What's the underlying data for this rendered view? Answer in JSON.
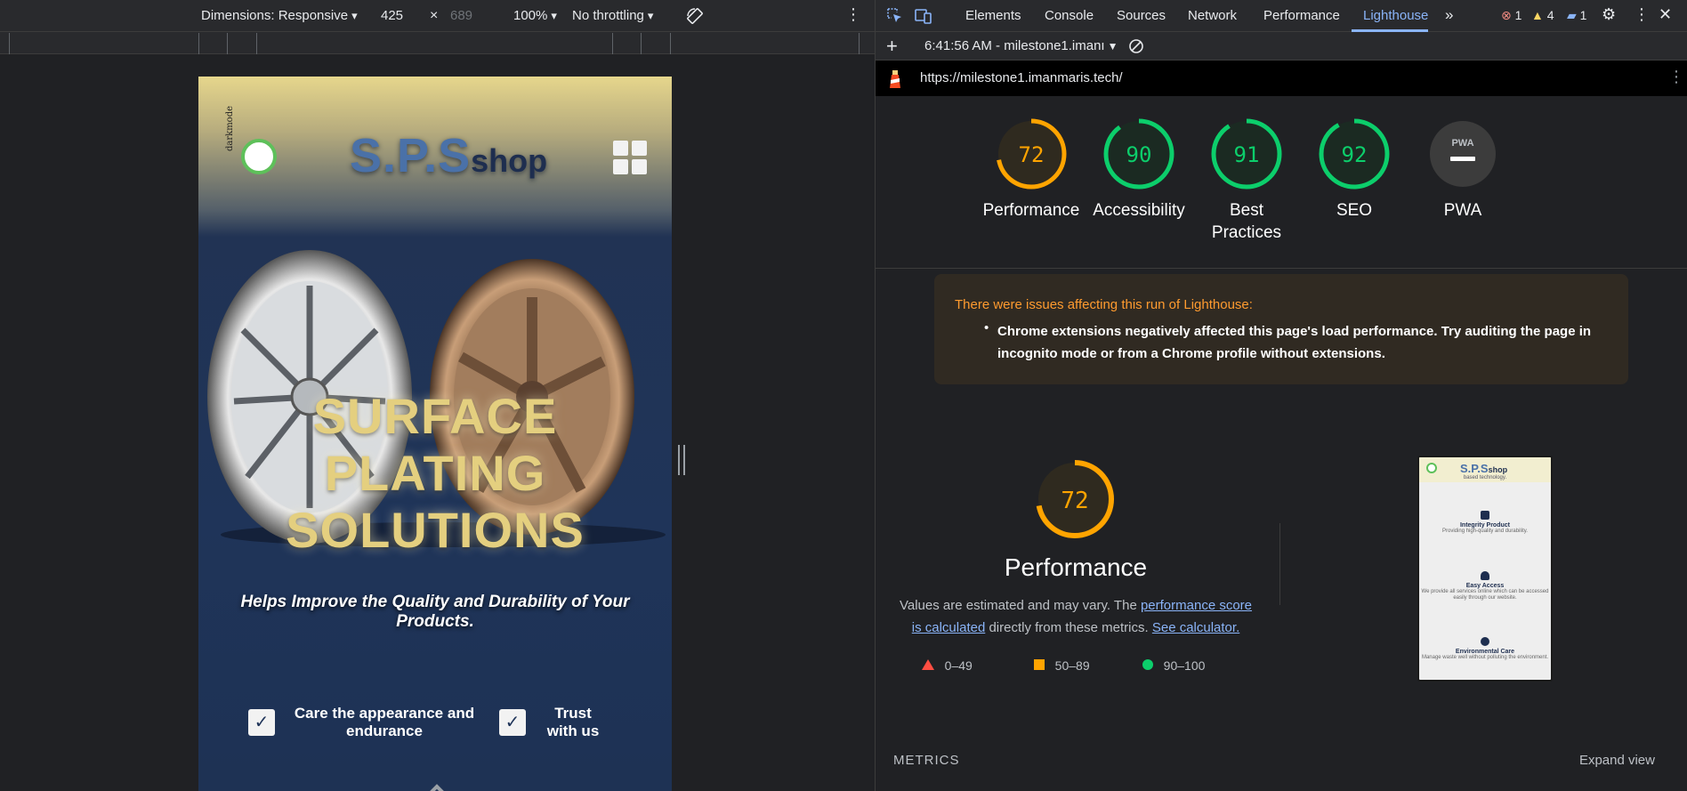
{
  "device_toolbar": {
    "dimensions": "Dimensions: Responsive",
    "width": "425",
    "height": "689",
    "zoom": "100%",
    "throttling": "No throttling"
  },
  "site": {
    "dark_label": "darkmode",
    "logo_big": "S.P.S",
    "logo_small": "shop",
    "hero_title": "SURFACE PLATING SOLUTIONS",
    "hero_subtitle": "Helps Improve the Quality and Durability of Your Products.",
    "features": [
      {
        "label": "Care the appearance and endurance"
      },
      {
        "label": "Trust with us"
      }
    ],
    "check_glyph": "✓"
  },
  "devtools": {
    "tabs": [
      "Elements",
      "Console",
      "Sources",
      "Network",
      "Performance",
      "Lighthouse"
    ],
    "active_tab": "Lighthouse",
    "errors": "1",
    "warnings": "4",
    "messages": "1",
    "report_time": "6:41:56 AM - milestone1.imanı",
    "url": "https://milestone1.imanmaris.tech/"
  },
  "gauges": [
    {
      "label": "Performance",
      "score": 72,
      "color": "#ffa400",
      "bg": "#2f2a1f"
    },
    {
      "label": "Accessibility",
      "score": 90,
      "color": "#0cce6b",
      "bg": "#1b2a22"
    },
    {
      "label": "Best Practices",
      "score": 91,
      "color": "#0cce6b",
      "bg": "#1b2a22"
    },
    {
      "label": "SEO",
      "score": 92,
      "color": "#0cce6b",
      "bg": "#1b2a22"
    },
    {
      "label": "PWA",
      "score": null,
      "color": "#9aa0a6",
      "bg": "#3c3c3c",
      "icon_text": "PWA"
    }
  ],
  "warning": {
    "title": "There were issues affecting this run of Lighthouse:",
    "text": "Chrome extensions negatively affected this page's load performance. Try auditing the page in incognito mode or from a Chrome profile without extensions."
  },
  "performance": {
    "score": "72",
    "title": "Performance",
    "desc_1": "Values are estimated and may vary. The ",
    "link_1": "performance score is calculated",
    "desc_2": " directly from these metrics. ",
    "link_2": "See calculator.",
    "legend": [
      {
        "range": "0–49",
        "shape": "triangle",
        "color": "#ff4e42"
      },
      {
        "range": "50–89",
        "shape": "square",
        "color": "#ffa400"
      },
      {
        "range": "90–100",
        "shape": "circle",
        "color": "#0cce6b"
      }
    ]
  },
  "thumbnail": {
    "logo_big": "S.P.S",
    "logo_small": "shop",
    "tagline": "based technology.",
    "items": [
      {
        "title": "Integrity Product",
        "desc": "Providing high-quality and durability."
      },
      {
        "title": "Easy Access",
        "desc": "We provide all services online which can be accessed easily through our website."
      },
      {
        "title": "Environmental Care",
        "desc": "Manage waste well without polluting the environment."
      }
    ]
  },
  "metrics": {
    "label": "METRICS",
    "expand": "Expand view"
  }
}
